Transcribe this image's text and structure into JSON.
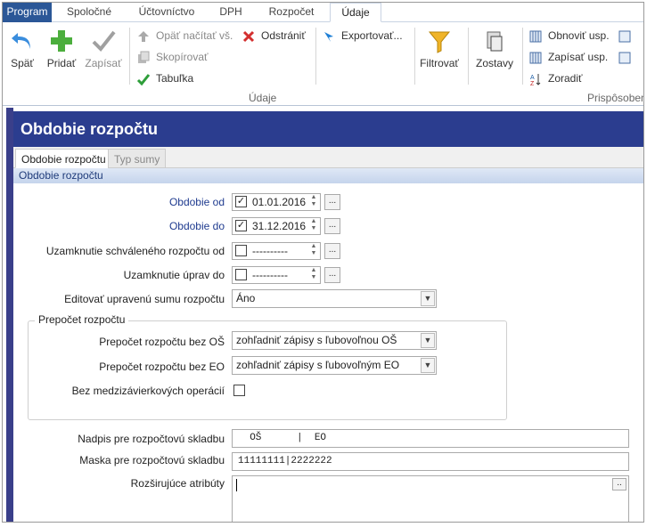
{
  "ribbon_tabs": [
    "Program",
    "Spoločné",
    "Účtovníctvo",
    "DPH",
    "Rozpočet",
    "Údaje"
  ],
  "toolbar": {
    "back": "Späť",
    "add": "Pridať",
    "write": "Zapísať",
    "reload": "Opäť načítať vš.",
    "delete": "Odstrániť",
    "copy": "Skopírovať",
    "table": "Tabuľka",
    "export": "Exportovať...",
    "filter": "Filtrovať",
    "reports": "Zostavy",
    "refresh_settings": "Obnoviť usp.",
    "save_settings": "Zapísať usp.",
    "sort": "Zoradiť",
    "group_data": "Údaje",
    "group_customize": "Prispôsoben"
  },
  "page": {
    "title": "Obdobie rozpočtu"
  },
  "subtabs": [
    "Obdobie rozpočtu",
    "Typ sumy"
  ],
  "section": "Obdobie rozpočtu",
  "form": {
    "period_from_label": "Obdobie od",
    "period_from": "01.01.2016",
    "period_to_label": "Obdobie do",
    "period_to": "31.12.2016",
    "lock_approved_label": "Uzamknutie schváleného rozpočtu od",
    "lock_approved": "----------",
    "lock_edit_label": "Uzamknutie úprav do",
    "lock_edit": "----------",
    "edit_sum_label": "Editovať upravenú sumu rozpočtu",
    "edit_sum": "Áno",
    "recalc_legend": "Prepočet rozpočtu",
    "recalc_os_label": "Prepočet rozpočtu bez OŠ",
    "recalc_os": "zohľadniť zápisy s ľubovoľnou OŠ",
    "recalc_eo_label": "Prepočet rozpočtu bez EO",
    "recalc_eo": "zohľadniť zápisy s ľubovoľným EO",
    "interaccount_label": "Bez medzizávierkových operácií",
    "caption_label": "Nadpis pre rozpočtovú skladbu",
    "caption": "  OŠ      |  EO",
    "mask_label": "Maska pre rozpočtovú skladbu",
    "mask": "11111111|2222222",
    "attributes_label": "Rozširujúce atribúty"
  }
}
